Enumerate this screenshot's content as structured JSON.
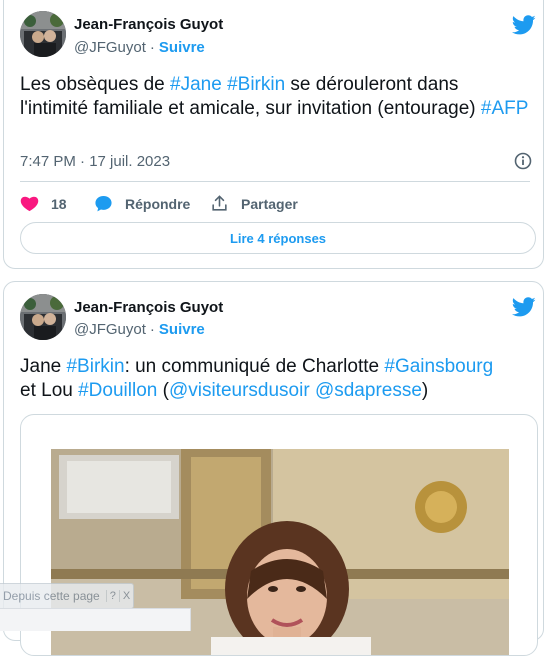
{
  "colors": {
    "accent": "#1d9bf0",
    "like": "#f91880",
    "muted": "#536471",
    "border": "#cfd9de"
  },
  "tweet1": {
    "author_name": "Jean-François Guyot",
    "handle": "@JFGuyot",
    "separator": "·",
    "follow_label": "Suivre",
    "text_parts": {
      "p1": "Les obsèques de ",
      "t1": "#Jane",
      "p2": " ",
      "t2": "#Birkin",
      "p3": " se dérouleront dans l'intimité familiale et amicale, sur invitation (entourage) ",
      "t3": "#AFP"
    },
    "timestamp": "7:47 PM · 17 juil. 2023",
    "likes": "18",
    "reply_label": "Répondre",
    "share_label": "Partager",
    "read_replies_label": "Lire 4 réponses",
    "icons": [
      "avatar",
      "twitter-bird-icon",
      "info-icon",
      "heart-icon",
      "reply-bubble-icon",
      "share-icon"
    ]
  },
  "tweet2": {
    "author_name": "Jean-François Guyot",
    "handle": "@JFGuyot",
    "separator": "·",
    "follow_label": "Suivre",
    "text_parts": {
      "p1": "Jane ",
      "t1": "#Birkin",
      "p2": ": un communiqué de Charlotte ",
      "t2": "#Gainsbourg",
      "p3": " et Lou ",
      "t3": "#Douillon",
      "p4": " (",
      "t4": "@visiteursdusoir",
      "p5": " ",
      "t5": "@sdapresse",
      "p6": ")"
    },
    "icons": [
      "avatar",
      "twitter-bird-icon",
      "tweet-photo"
    ]
  },
  "overlay": {
    "tip_text": "Depuis cette page",
    "help_label": "?",
    "close_label": "X"
  }
}
